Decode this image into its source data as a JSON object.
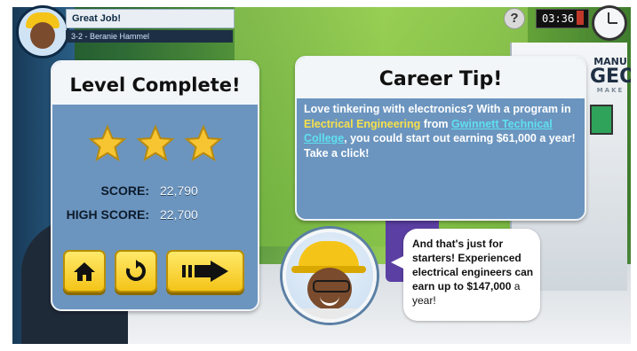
{
  "hud": {
    "title": "Great Job!",
    "subtitle": "3-2 - Beranie Hammel",
    "help_label": "?",
    "timer": "03:36",
    "sign": {
      "line1": "MANU",
      "line2": "GEO",
      "line3": "MAKE"
    }
  },
  "level": {
    "title": "Level Complete!",
    "stars_earned": 3,
    "stars_total": 3,
    "score_label": "SCORE:",
    "score_value": "22,790",
    "high_score_label": "HIGH SCORE:",
    "high_score_value": "22,700",
    "buttons": [
      {
        "icon": "home-icon"
      },
      {
        "icon": "replay-icon"
      },
      {
        "icon": "next-arrow-icon"
      }
    ]
  },
  "career_tip": {
    "title": "Career Tip!",
    "text_1": "Love tinkering with electronics? With a program in ",
    "program": "Electrical Engineering",
    "text_2": " from ",
    "college": "Gwinnett Technical College",
    "text_3": ", you could start out earning ",
    "salary": "$61,000",
    "text_4": " a year! Take a click!"
  },
  "bubble": {
    "text_1": "And that's just for starters! Experienced electrical engineers can earn up to ",
    "salary": "$147,000",
    "text_2": " a year!"
  },
  "colors": {
    "panel": "#6b95bf",
    "header": "#f3f6f8",
    "button": "#f4c418",
    "highlight": "#f7e04a",
    "link": "#5fe0f0",
    "star": "#f7c531"
  }
}
